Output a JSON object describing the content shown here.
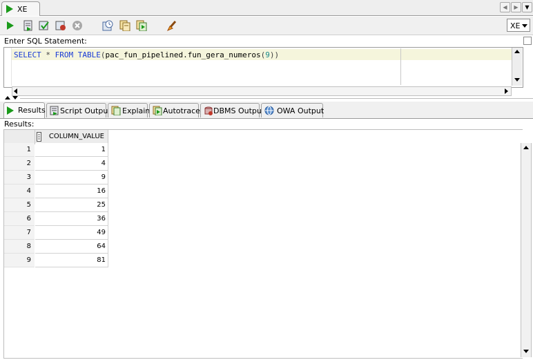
{
  "editor_tab": {
    "label": "XE"
  },
  "toolbar": {
    "icons": [
      "run-statement-icon",
      "run-script-icon",
      "commit-icon",
      "rollback-icon",
      "cancel-icon",
      "sql-history-icon",
      "unshared-worksheet-icon",
      "explain-plan-icon",
      "clear-icon"
    ],
    "connection": "XE"
  },
  "sql_editor": {
    "label": "Enter SQL Statement:",
    "tokens": [
      "SELECT",
      " * ",
      "FROM",
      " ",
      "TABLE",
      "(",
      "pac_fun_pipelined.fun_gera_numeros",
      "(",
      "9",
      "))"
    ]
  },
  "result_tabs": [
    {
      "label": "Results",
      "active": true
    },
    {
      "label": "Script Output",
      "active": false
    },
    {
      "label": "Explain",
      "active": false
    },
    {
      "label": "Autotrace",
      "active": false
    },
    {
      "label": "DBMS Output",
      "active": false
    },
    {
      "label": "OWA Output",
      "active": false
    }
  ],
  "results": {
    "label": "Results:",
    "column": "COLUMN_VALUE",
    "rows": [
      {
        "n": "1",
        "v": "1"
      },
      {
        "n": "2",
        "v": "4"
      },
      {
        "n": "3",
        "v": "9"
      },
      {
        "n": "4",
        "v": "16"
      },
      {
        "n": "5",
        "v": "25"
      },
      {
        "n": "6",
        "v": "36"
      },
      {
        "n": "7",
        "v": "49"
      },
      {
        "n": "8",
        "v": "64"
      },
      {
        "n": "9",
        "v": "81"
      }
    ]
  },
  "colors": {
    "keyword": "#1a3bd6",
    "number": "#1a8a8a",
    "run_green": "#1a9a1a"
  }
}
